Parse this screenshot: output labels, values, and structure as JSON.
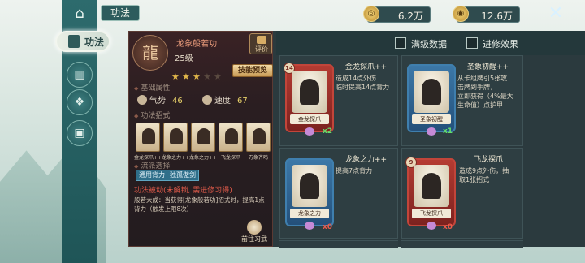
{
  "header": {
    "tab_title": "功法",
    "currency_1": "6.2万",
    "currency_2": "12.6万",
    "close_icon": "close-x-icon"
  },
  "nav": {
    "active_label": "功法",
    "icons": [
      "home-icon",
      "card-deck-icon",
      "card-stack-icon",
      "crest-icon",
      "token-icon"
    ]
  },
  "detail": {
    "name": "龙象般若功",
    "level": "25级",
    "stars_filled": 3,
    "stars_total": 5,
    "review_label": "评价",
    "preview_label": "技能预览",
    "section_basic": "基础属性",
    "attr_1_label": "气势",
    "attr_1_value": "46",
    "attr_2_label": "速度",
    "attr_2_value": "67",
    "section_moves": "功法招式",
    "moves": [
      "金龙探爪++",
      "龙象之力++",
      "龙象之力++",
      "飞龙探爪",
      "万象齐鸣"
    ],
    "section_tags": "流派选择",
    "tag_1": "通用背力",
    "tag_2": "独孤傲剑",
    "passive_title": "功法被动(未解锁, 需进修习得)",
    "passive_desc": "般若大成：当获得[龙象般若功]招式时，提高1点背力（触发上限8次）",
    "goto_label": "前往习武"
  },
  "filters": {
    "max_data_label": "满级数据",
    "advance_label": "进修效果"
  },
  "cards": [
    {
      "title": "金龙探爪++",
      "card_name": "金龙探爪",
      "cost": "14",
      "count": "x2",
      "desc": "造成14点外伤\n临时提高14点背力",
      "color": "red"
    },
    {
      "title": "圣象初醒++",
      "card_name": "圣象初醒",
      "cost": "",
      "count": "x1",
      "desc": "从卡组牌引5张攻\n击牌到手牌，\n立即获得（4%最大\n生命值）点护甲",
      "color": "blue"
    },
    {
      "title": "龙象之力++",
      "card_name": "龙象之力",
      "cost": "",
      "count": "x0",
      "desc": "提高7点背力",
      "color": "blue"
    },
    {
      "title": "飞龙探爪",
      "card_name": "飞龙探爪",
      "cost": "9",
      "count": "x0",
      "desc": "造成9点外伤，抽\n取1张招式",
      "color": "red"
    }
  ]
}
